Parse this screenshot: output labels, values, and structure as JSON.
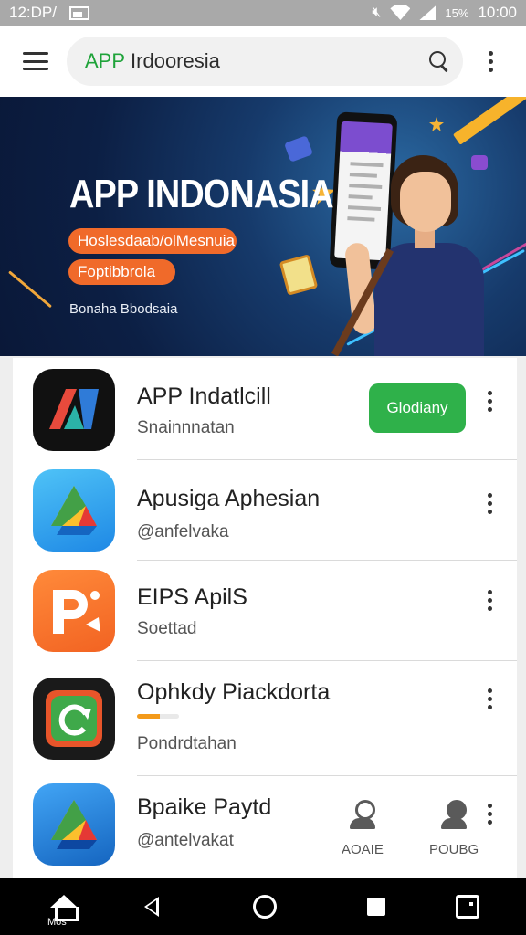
{
  "status_bar": {
    "time_left": "12:DP/",
    "battery": "15%",
    "time_right": "10:00",
    "icons": [
      "photo-icon",
      "mute-icon",
      "wifi-icon",
      "signal-icon",
      "battery-icon"
    ]
  },
  "app_bar": {
    "search_text_brand": "APP",
    "search_text_query": "Irdooresia",
    "icons": [
      "menu-icon",
      "search-icon",
      "overflow-menu-icon"
    ]
  },
  "banner": {
    "title": "APP INDONASIA",
    "pill_1": "Hoslesdaab/olMesnuia",
    "pill_2": "Foptibbrola",
    "footer": "Bonaha Bbodsaia"
  },
  "apps": [
    {
      "title": "APP Indatlcill",
      "subtitle": "Snainnnatan",
      "action": "Glodiany",
      "icon": "app-indonesia-logo"
    },
    {
      "title": "Apusiga Aphesian",
      "subtitle": "@anfelvaka",
      "icon": "triangle-app-logo"
    },
    {
      "title": "EIPS ApilS",
      "subtitle": "Soettad",
      "icon": "p-app-logo"
    },
    {
      "title": "Ophkdy Piackdorta",
      "subtitle": "Pondrdtahan",
      "progress": 0.55,
      "icon": "refresh-app-logo"
    },
    {
      "title": "Bpaike Paytd",
      "subtitle": "@antelvakat",
      "icon": "triangle-app-logo"
    }
  ],
  "mini_actions": [
    {
      "label": "AOAIE",
      "icon": "person-outline-icon"
    },
    {
      "label": "POUBG",
      "icon": "person-filled-icon"
    }
  ],
  "nav_bar": {
    "home_label": "Mos",
    "icons": [
      "home-icon",
      "back-icon",
      "home-circle-icon",
      "stop-icon",
      "recents-icon"
    ]
  },
  "colors": {
    "accent_green": "#2fb14a",
    "brand_orange": "#f06a2a",
    "banner_dark": "#0c1f44"
  }
}
